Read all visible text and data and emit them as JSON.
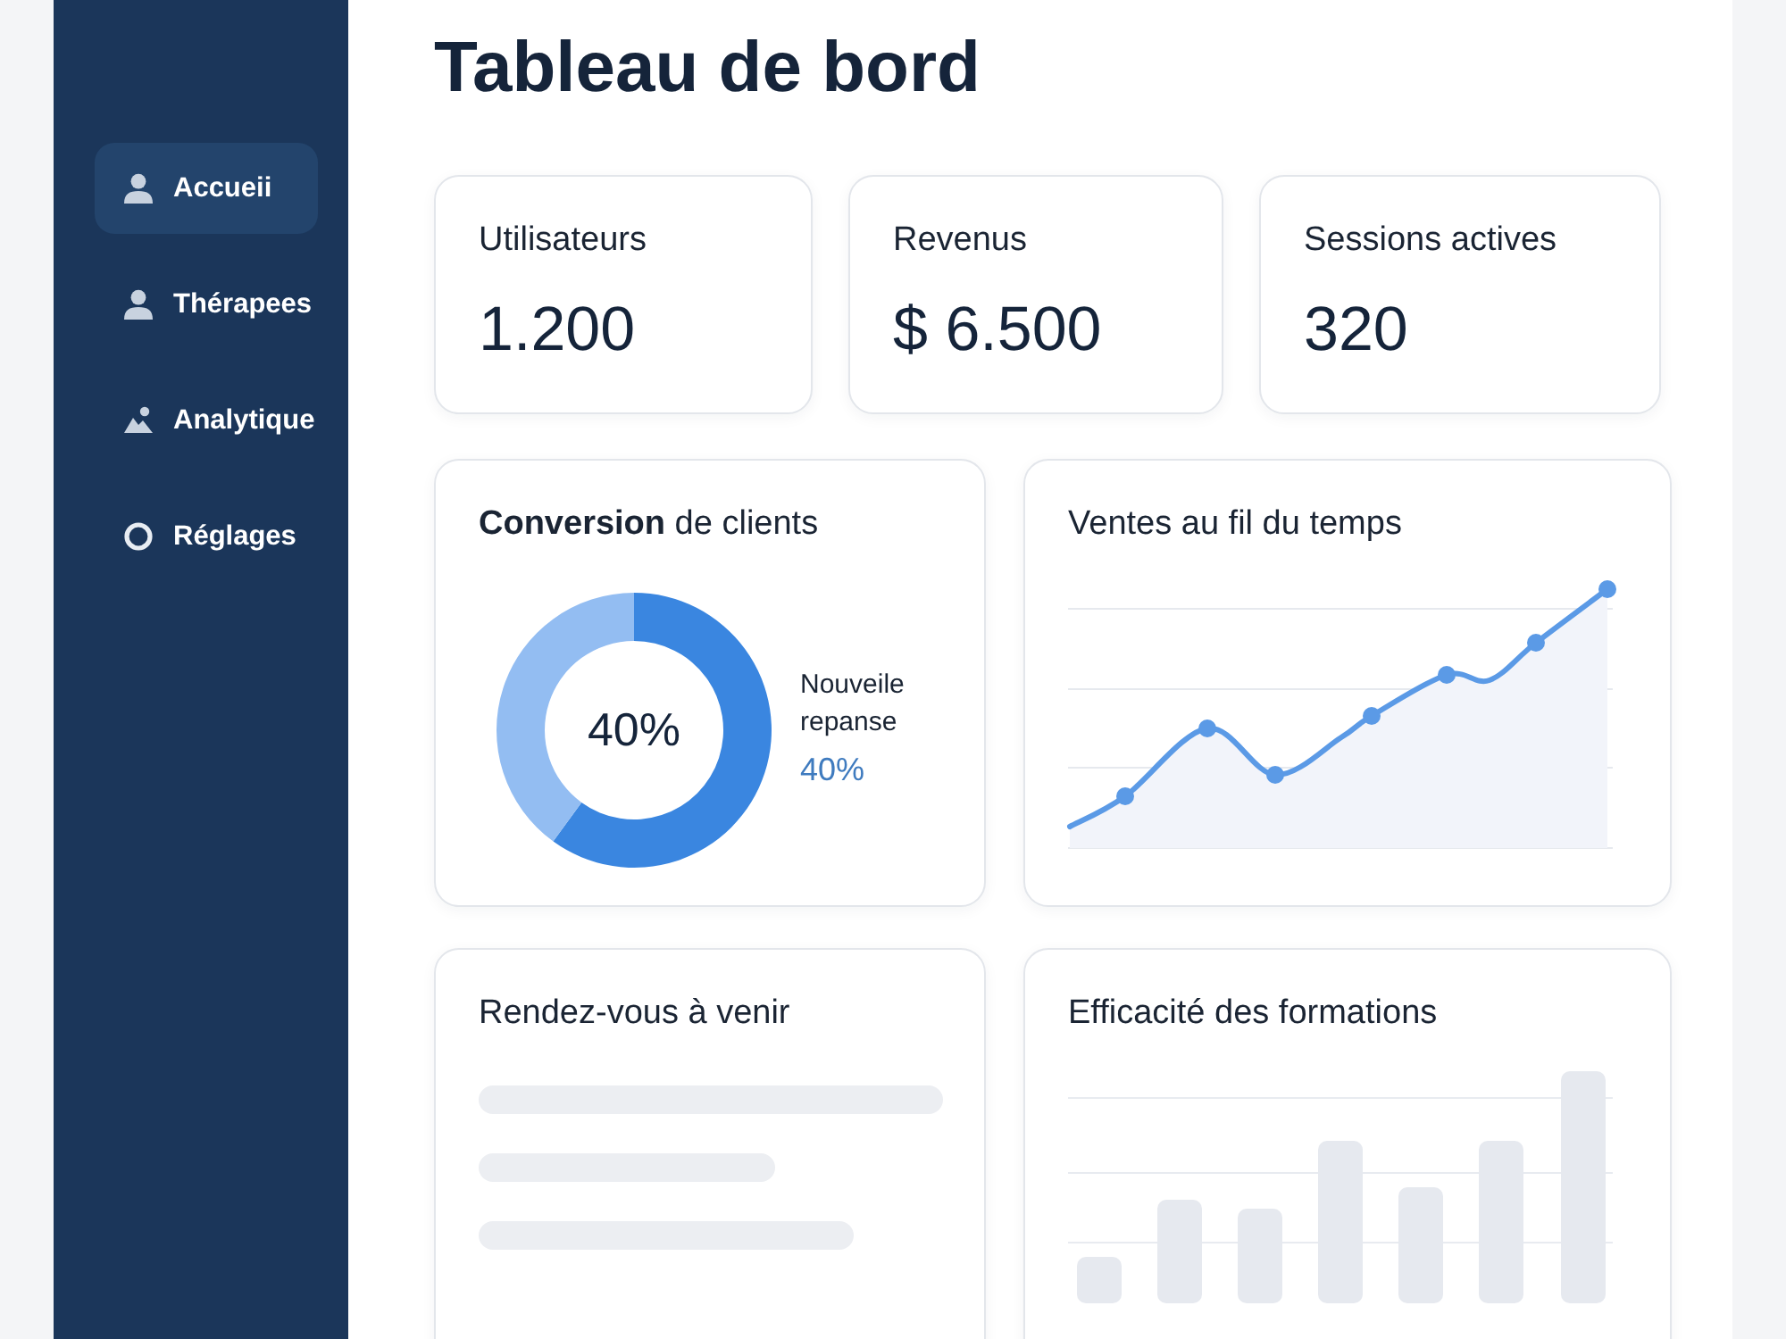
{
  "sidebar": {
    "items": [
      {
        "label": "Accueii",
        "selected": true
      },
      {
        "label": "Thérapees",
        "selected": false
      },
      {
        "label": "Analytique",
        "selected": false
      },
      {
        "label": "Réglages",
        "selected": false
      }
    ]
  },
  "page": {
    "title": "Tableau de bord"
  },
  "stats": [
    {
      "label": "Utilisateurs",
      "value": "1.200"
    },
    {
      "label": "Revenus",
      "value": "$ 6.500"
    },
    {
      "label": "Sessions actives",
      "value": "320"
    }
  ],
  "conversion": {
    "title": "**Conversion** de clients",
    "center_label": "40%",
    "legend": {
      "label": "Nouveile repanse",
      "value": "40%"
    }
  },
  "sales": {
    "title": "Ventes au fil du temps"
  },
  "appointments": {
    "title": "Rendez-vous à venir"
  },
  "training": {
    "title": "Efficacité des formations"
  }
}
